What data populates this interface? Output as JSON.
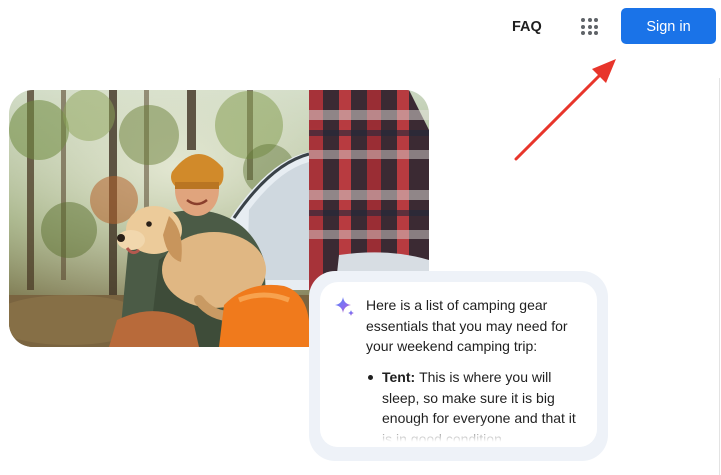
{
  "header": {
    "faq_label": "FAQ",
    "apps_icon": "apps-grid-icon",
    "signin_label": "Sign in",
    "signin_color": "#1a73e8"
  },
  "hero": {
    "photo": "camping-photo"
  },
  "chat": {
    "icon": "sparkle-icon",
    "intro": "Here is a list of camping gear essentials that you may need for your weekend camping trip:",
    "items": [
      {
        "term": "Tent:",
        "text": "This is where you will sleep, so make sure it is big enough for everyone and that it is in good condition."
      }
    ]
  },
  "annotation": {
    "arrow_color": "#e8352b"
  }
}
